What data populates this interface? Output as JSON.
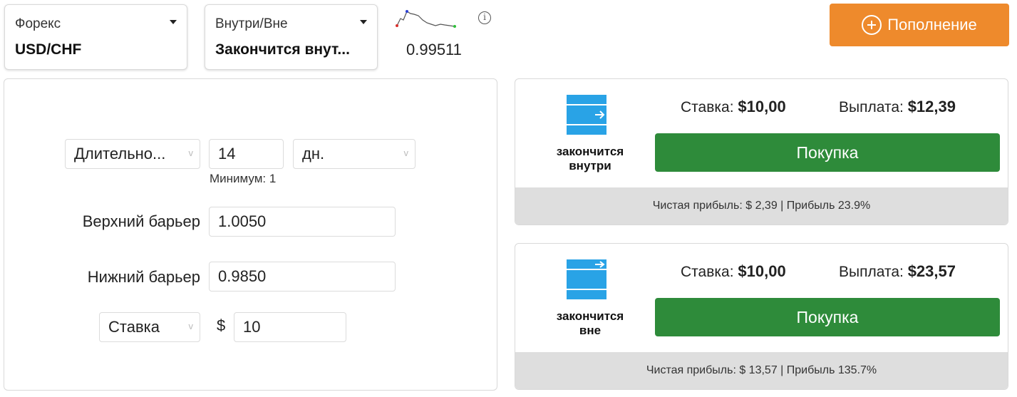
{
  "asset": {
    "label": "Форекс",
    "value": "USD/CHF"
  },
  "contract_type": {
    "label": "Внутри/Вне",
    "value": "Закончится внут..."
  },
  "spot": {
    "price": "0.99511",
    "info_icon": "info-icon",
    "sparkline_colors": {
      "line": "#555555",
      "start": "#d9302c",
      "high": "#2a3fd4",
      "end": "#2fbf3a"
    }
  },
  "deposit": {
    "label": "Пополнение",
    "icon": "plus-circle-icon",
    "color": "#ee8a2c"
  },
  "form": {
    "duration_type": "Длительно...",
    "duration_value": "14",
    "duration_unit": "дн.",
    "min_hint": "Минимум: 1",
    "upper_barrier_label": "Верхний барьер",
    "upper_barrier_value": "1.0050",
    "lower_barrier_label": "Нижний барьер",
    "lower_barrier_value": "0.9850",
    "stake_type": "Ставка",
    "currency_sign": "$",
    "stake_value": "10"
  },
  "contracts": [
    {
      "icon": "ends-inside-icon",
      "title_line1": "закончится",
      "title_line2": "внутри",
      "stake_label": "Ставка:",
      "stake_value": "$10,00",
      "payout_label": "Выплата:",
      "payout_value": "$12,39",
      "buy_label": "Покупка",
      "footer": "Чистая прибыль: $ 2,39 | Прибыль 23.9%"
    },
    {
      "icon": "ends-outside-icon",
      "title_line1": "закончится",
      "title_line2": "вне",
      "stake_label": "Ставка:",
      "stake_value": "$10,00",
      "payout_label": "Выплата:",
      "payout_value": "$23,57",
      "buy_label": "Покупка",
      "footer": "Чистая прибыль: $ 13,57 | Прибыль 135.7%"
    }
  ],
  "colors": {
    "buy": "#2e8b3a",
    "icon_blue": "#29a3e6",
    "footer_bg": "#dedede"
  }
}
